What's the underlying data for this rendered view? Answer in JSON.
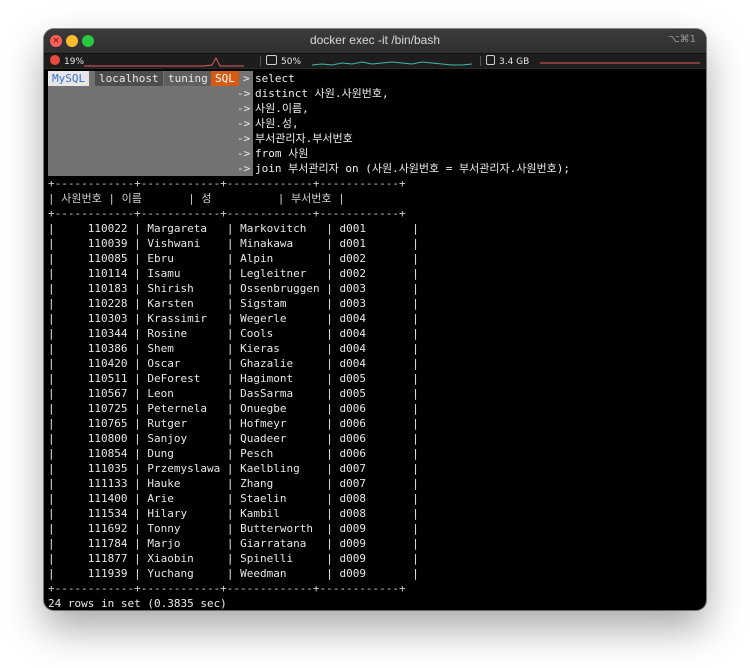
{
  "window": {
    "title": "docker exec -it  /bin/bash",
    "shortcut": "⌥⌘1"
  },
  "status": {
    "cpu": "19%",
    "gpu": "50%",
    "memory": "3.4 GB"
  },
  "prompt": {
    "client": "MySQL",
    "host": "localhost",
    "database": "tuning",
    "mode": "SQL",
    "arrow": ">",
    "continuation": "->"
  },
  "query_lines": [
    "select",
    "distinct 사원.사원번호,",
    "사원.이름,",
    "사원.성,",
    "부서관리자.부서번호",
    "from 사원",
    "join 부서관리자 on (사원.사원번호 = 부서관리자.사원번호);"
  ],
  "result": {
    "border_line": "+------------+------------+-------------+------------+",
    "header_line": "| 사원번호 | 이름       | 성          | 부서번호 |",
    "columns": [
      "사원번호",
      "이름",
      "성",
      "부서번호"
    ],
    "rows": [
      [
        "110022",
        "Margareta",
        "Markovitch",
        "d001"
      ],
      [
        "110039",
        "Vishwani",
        "Minakawa",
        "d001"
      ],
      [
        "110085",
        "Ebru",
        "Alpin",
        "d002"
      ],
      [
        "110114",
        "Isamu",
        "Legleitner",
        "d002"
      ],
      [
        "110183",
        "Shirish",
        "Ossenbruggen",
        "d003"
      ],
      [
        "110228",
        "Karsten",
        "Sigstam",
        "d003"
      ],
      [
        "110303",
        "Krassimir",
        "Wegerle",
        "d004"
      ],
      [
        "110344",
        "Rosine",
        "Cools",
        "d004"
      ],
      [
        "110386",
        "Shem",
        "Kieras",
        "d004"
      ],
      [
        "110420",
        "Oscar",
        "Ghazalie",
        "d004"
      ],
      [
        "110511",
        "DeForest",
        "Hagimont",
        "d005"
      ],
      [
        "110567",
        "Leon",
        "DasSarma",
        "d005"
      ],
      [
        "110725",
        "Peternela",
        "Onuegbe",
        "d006"
      ],
      [
        "110765",
        "Rutger",
        "Hofmeyr",
        "d006"
      ],
      [
        "110800",
        "Sanjoy",
        "Quadeer",
        "d006"
      ],
      [
        "110854",
        "Dung",
        "Pesch",
        "d006"
      ],
      [
        "111035",
        "Przemyslawa",
        "Kaelbling",
        "d007"
      ],
      [
        "111133",
        "Hauke",
        "Zhang",
        "d007"
      ],
      [
        "111400",
        "Arie",
        "Staelin",
        "d008"
      ],
      [
        "111534",
        "Hilary",
        "Kambil",
        "d008"
      ],
      [
        "111692",
        "Tonny",
        "Butterworth",
        "d009"
      ],
      [
        "111784",
        "Marjo",
        "Giarratana",
        "d009"
      ],
      [
        "111877",
        "Xiaobin",
        "Spinelli",
        "d009"
      ],
      [
        "111939",
        "Yuchang",
        "Weedman",
        "d009"
      ]
    ],
    "summary": "24 rows in set (0.3835 sec)"
  },
  "colors": {
    "terminal_bg": "#000000",
    "prompt_sql_bg": "#d55a12",
    "prompt_tile_bg": "#737373"
  }
}
